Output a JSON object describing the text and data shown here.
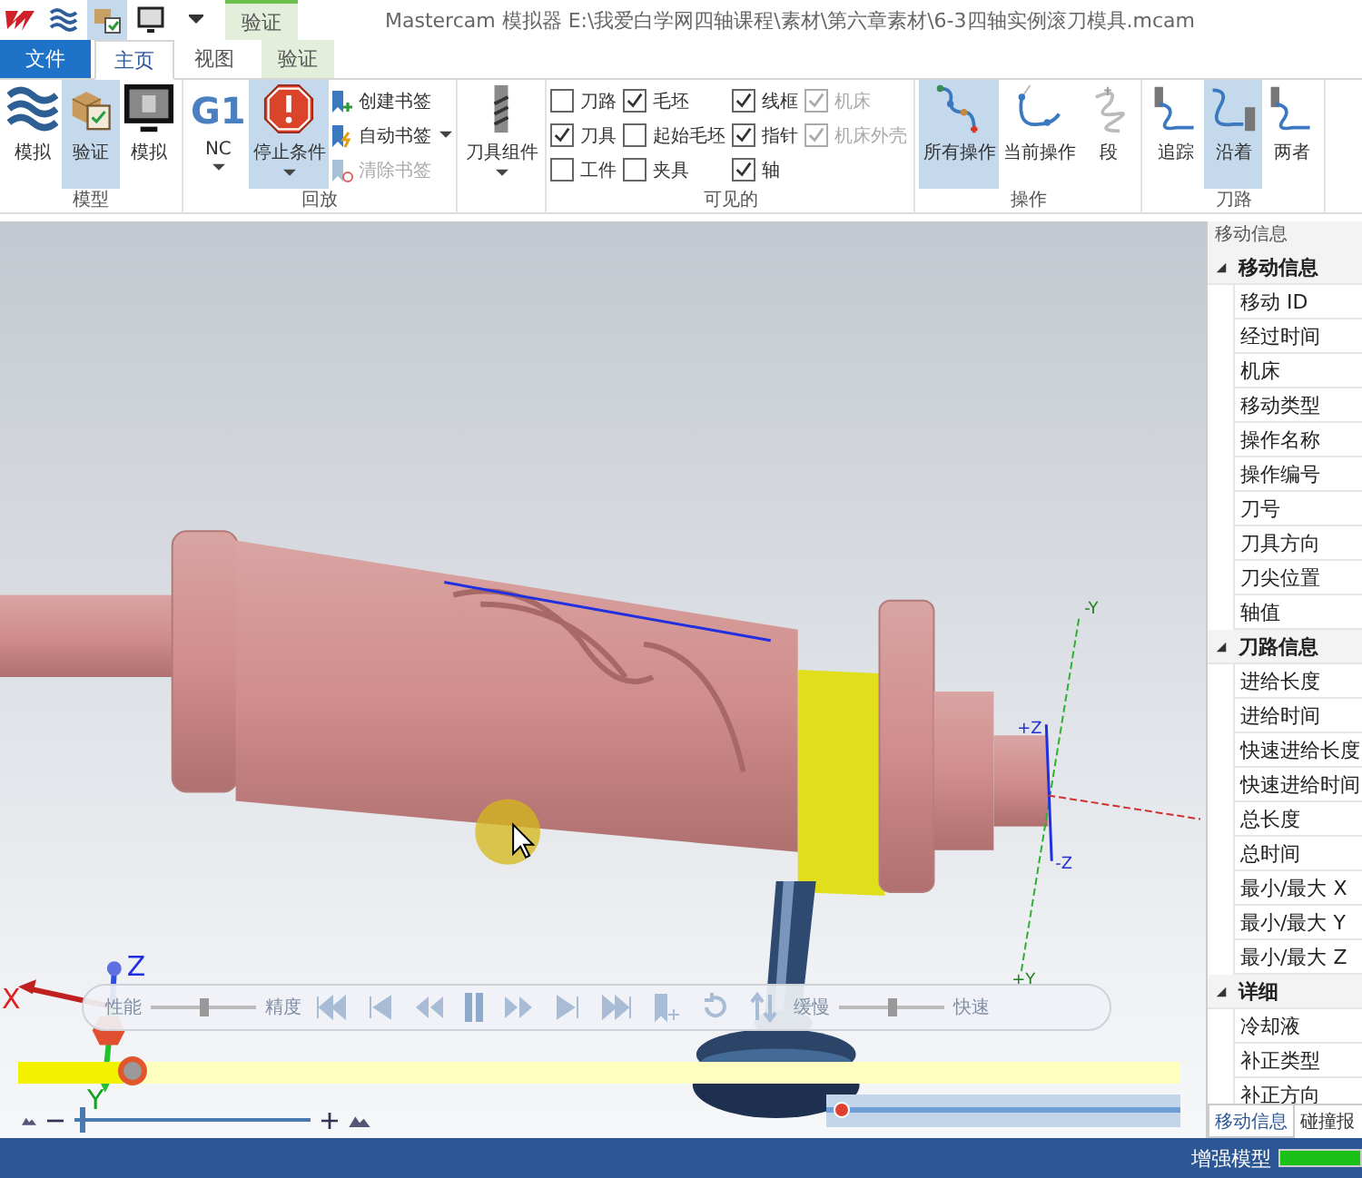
{
  "title_bar": {
    "context_group": "验证",
    "title": "Mastercam 模拟器  E:\\我爱白学网四轴课程\\素材\\第六章素材\\6-3四轴实例滚刀模具.mcam"
  },
  "quick_access": [
    {
      "selected": false
    },
    {
      "selected": true
    },
    {
      "selected": false
    }
  ],
  "tabs": [
    {
      "label": "文件",
      "kind": "file",
      "selected": false
    },
    {
      "label": "主页",
      "kind": "normal",
      "selected": true
    },
    {
      "label": "视图",
      "kind": "normal",
      "selected": false
    },
    {
      "label": "验证",
      "kind": "context",
      "selected": false
    }
  ],
  "model_group": {
    "label": "模型",
    "buttons": [
      {
        "label": "模拟",
        "selected": false
      },
      {
        "label": "验证",
        "selected": true
      },
      {
        "label": "模拟",
        "selected": false
      }
    ]
  },
  "playback_group": {
    "label": "回放",
    "nc": {
      "code": "G1",
      "label": "NC"
    },
    "stop": {
      "label": "停止条件",
      "selected": true
    },
    "bookmarks": [
      {
        "label": "创建书签",
        "disabled": false
      },
      {
        "label": "自动书签",
        "disabled": false
      },
      {
        "label": "清除书签",
        "disabled": true
      }
    ]
  },
  "tool_group": {
    "label": "刀具组件"
  },
  "visible_group": {
    "label": "可见的",
    "columns": [
      [
        {
          "label": "刀路",
          "checked": false,
          "disabled": false
        },
        {
          "label": "刀具",
          "checked": true,
          "disabled": false
        },
        {
          "label": "工件",
          "checked": false,
          "disabled": false
        }
      ],
      [
        {
          "label": "毛坯",
          "checked": true,
          "disabled": false
        },
        {
          "label": "起始毛坯",
          "checked": false,
          "disabled": false
        },
        {
          "label": "夹具",
          "checked": false,
          "disabled": false
        }
      ],
      [
        {
          "label": "线框",
          "checked": true,
          "disabled": false
        },
        {
          "label": "指针",
          "checked": true,
          "disabled": false
        },
        {
          "label": "轴",
          "checked": true,
          "disabled": false
        }
      ],
      [
        {
          "label": "机床",
          "checked": true,
          "disabled": true
        },
        {
          "label": "机床外壳",
          "checked": true,
          "disabled": true
        }
      ]
    ]
  },
  "operation_group": {
    "label": "操作",
    "buttons": [
      {
        "label": "所有操作",
        "selected": true
      },
      {
        "label": "当前操作",
        "selected": false
      },
      {
        "label": "段",
        "selected": false
      }
    ]
  },
  "toolpath_group": {
    "label": "刀路",
    "buttons": [
      {
        "label": "追踪",
        "selected": false
      },
      {
        "label": "沿着",
        "selected": true
      },
      {
        "label": "两者",
        "selected": false
      }
    ]
  },
  "viewport": {
    "axis_labels": [
      "-Y",
      "+Z",
      "-Z",
      "+Y"
    ],
    "triad": [
      "X",
      "Y",
      "Z"
    ],
    "playback": {
      "performance": "性能",
      "quality": "精度",
      "quality_slider": {
        "level": 0.5
      },
      "slow": "缓慢",
      "fast": "快速",
      "speed_slider": {
        "level": 0.5
      }
    },
    "progress": {
      "level": 0.09
    },
    "zoom_slider": {
      "level": 0.02
    },
    "position_slider": {
      "level": 0.04
    }
  },
  "info_panel": {
    "title": "移动信息",
    "sections": [
      {
        "label": "移动信息",
        "expanded": true,
        "children": [
          {
            "label": "移动 ID"
          },
          {
            "label": "经过时间"
          },
          {
            "label": "机床"
          },
          {
            "label": "移动类型"
          },
          {
            "label": "操作名称"
          },
          {
            "label": "操作编号"
          },
          {
            "label": "刀号"
          },
          {
            "label": "刀具方向"
          },
          {
            "label": "刀尖位置"
          },
          {
            "label": "轴值"
          }
        ]
      },
      {
        "label": "刀路信息",
        "expanded": true,
        "children": [
          {
            "label": "进给长度"
          },
          {
            "label": "进给时间"
          },
          {
            "label": "快速进给长度"
          },
          {
            "label": "快速进给时间"
          },
          {
            "label": "总长度"
          },
          {
            "label": "总时间"
          },
          {
            "label": "最小/最大 X"
          },
          {
            "label": "最小/最大 Y"
          },
          {
            "label": "最小/最大 Z"
          }
        ]
      },
      {
        "label": "详细",
        "expanded": true,
        "children": [
          {
            "label": "冷却液"
          },
          {
            "label": "补正类型"
          },
          {
            "label": "补正方向"
          }
        ]
      }
    ],
    "tabs": [
      {
        "label": "移动信息",
        "selected": true
      },
      {
        "label": "碰撞报",
        "selected": false
      }
    ]
  },
  "status_bar": {
    "label": "增强模型",
    "level": 1
  }
}
